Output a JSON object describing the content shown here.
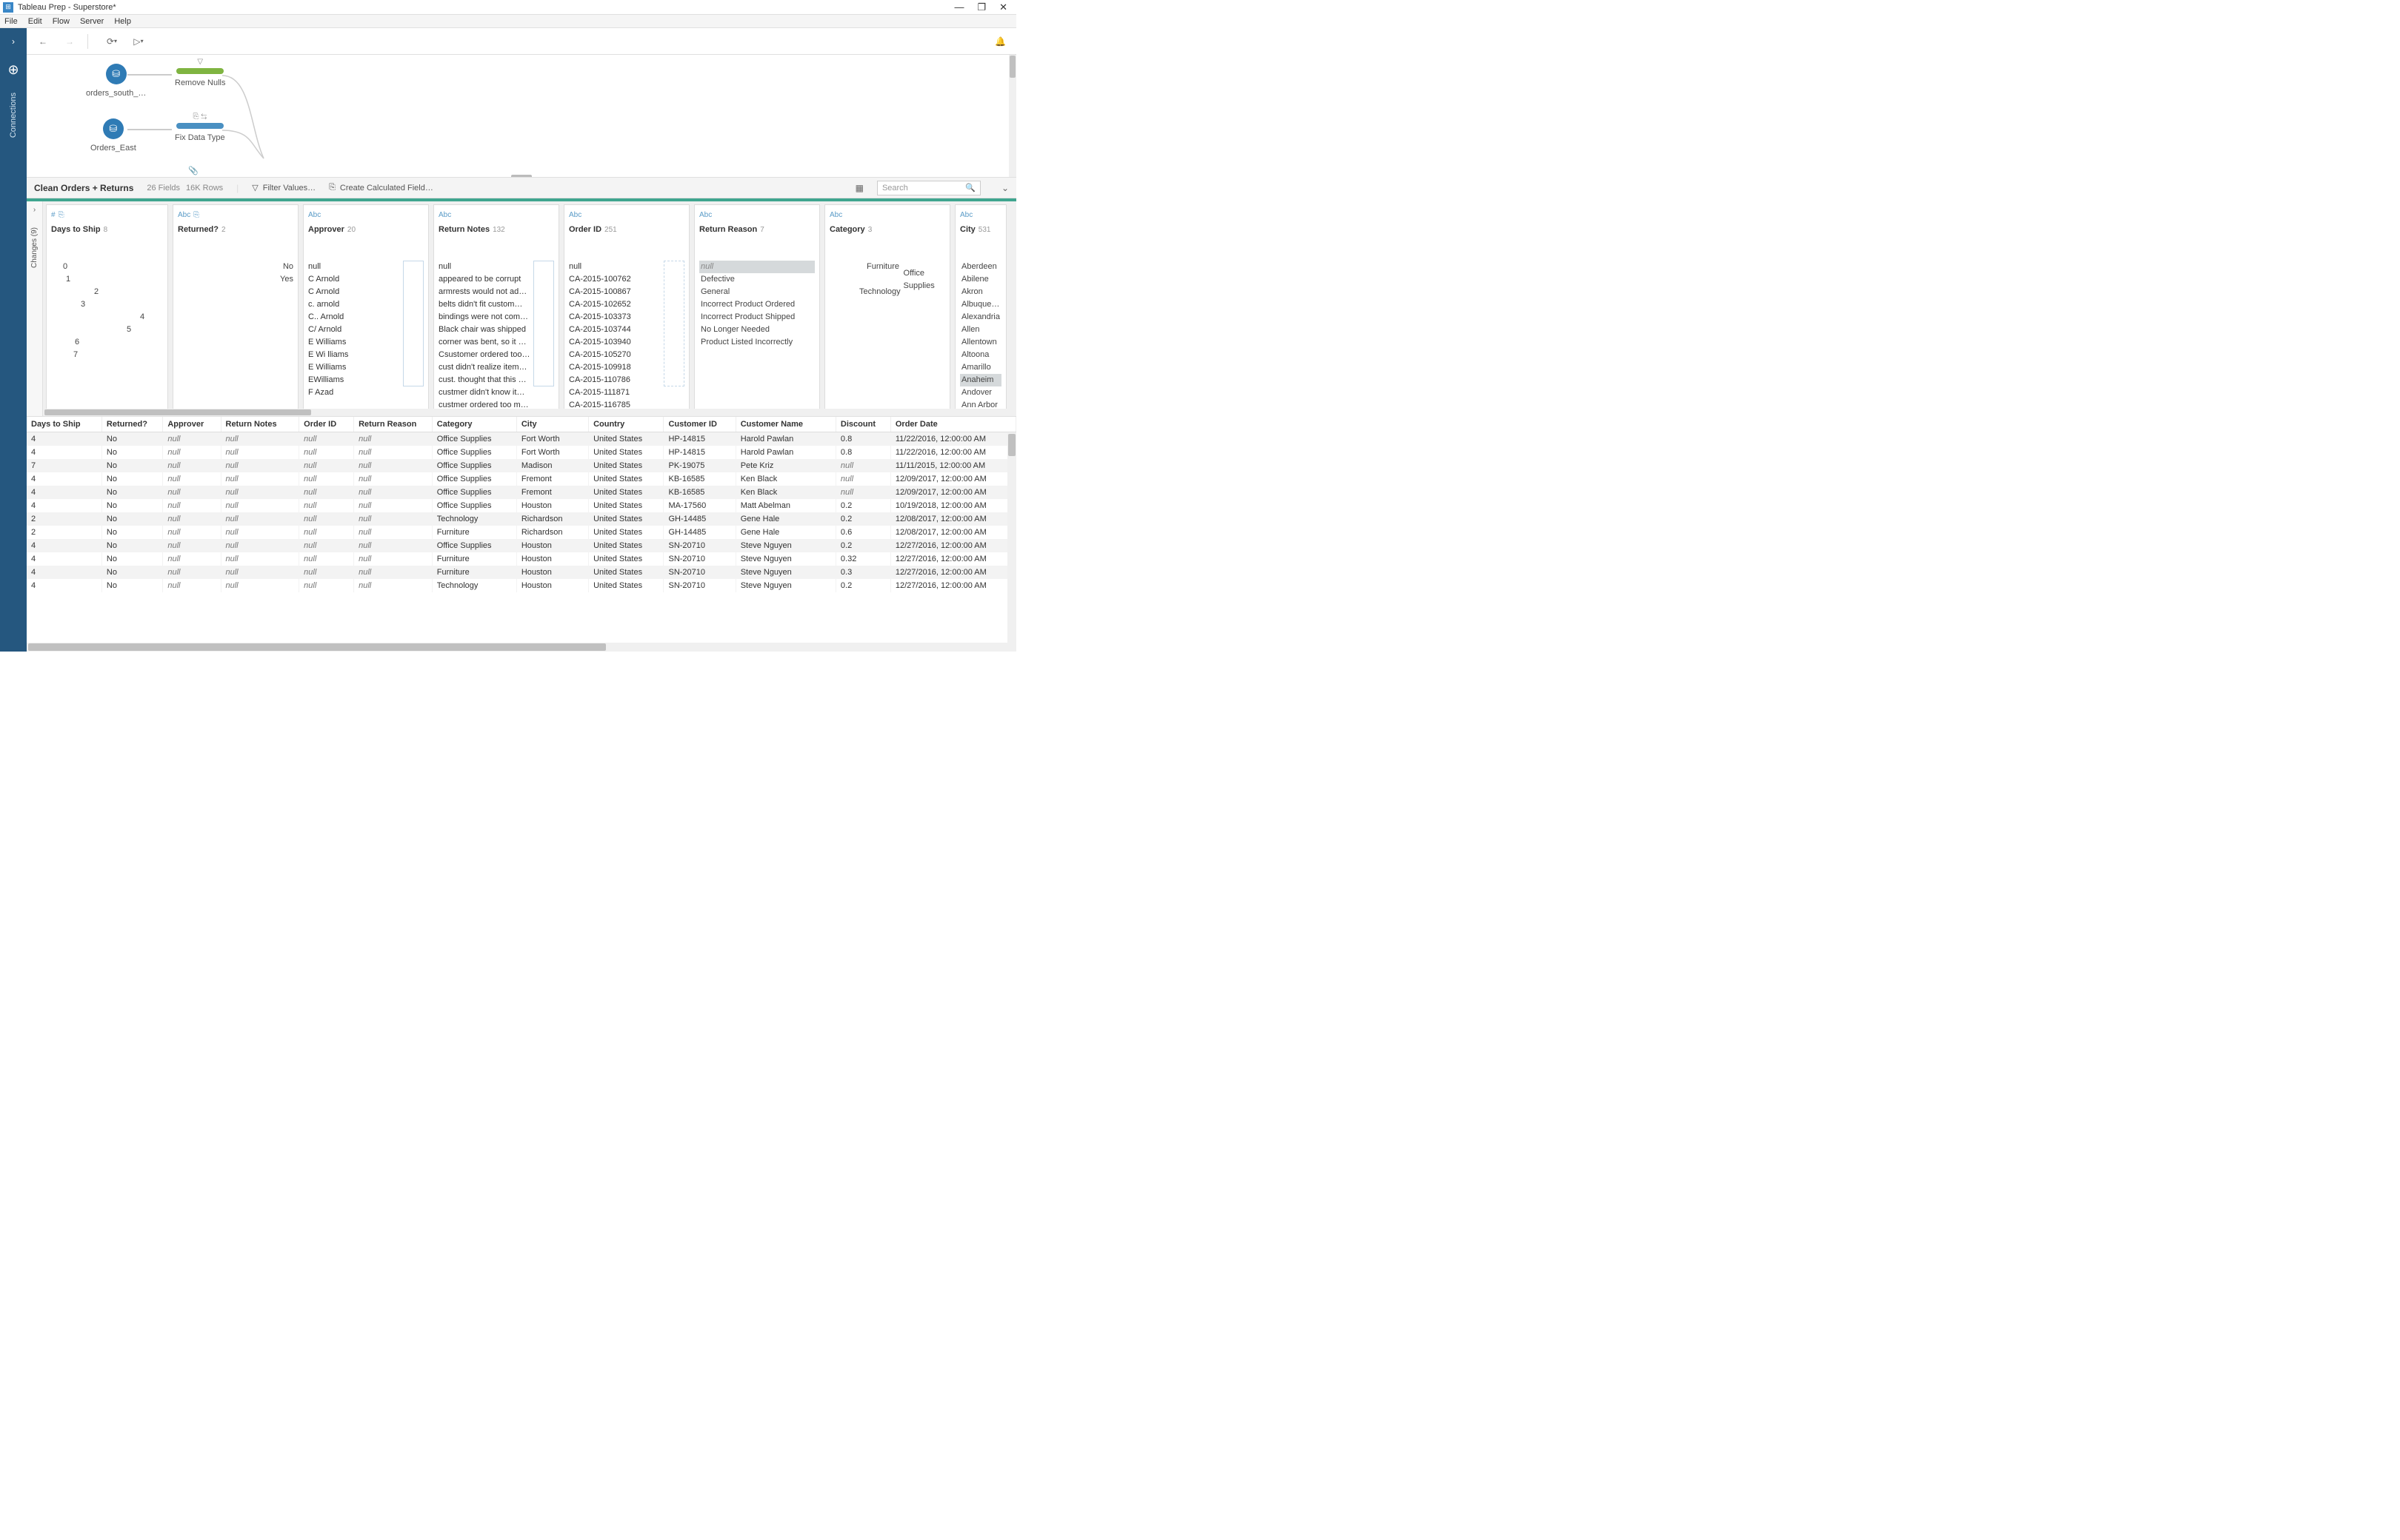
{
  "title": "Tableau Prep - Superstore*",
  "menu": [
    "File",
    "Edit",
    "Flow",
    "Server",
    "Help"
  ],
  "left_rail_label": "Connections",
  "flow": {
    "nodes": [
      {
        "id": "orders_south",
        "label": "orders_south_…",
        "kind": "source"
      },
      {
        "id": "remove_nulls",
        "label": "Remove Nulls",
        "kind": "clean",
        "color": "green",
        "icon": "filter"
      },
      {
        "id": "orders_east",
        "label": "Orders_East",
        "kind": "source"
      },
      {
        "id": "fix_type",
        "label": "Fix Data Type",
        "kind": "clean",
        "color": "blue",
        "icon": "rename"
      }
    ]
  },
  "step": {
    "name": "Clean Orders + Returns",
    "fields": "26 Fields",
    "rows": "16K Rows",
    "filter_label": "Filter Values…",
    "calc_label": "Create Calculated Field…",
    "search_placeholder": "Search"
  },
  "changes_label": "Changes (9)",
  "profile_cards": [
    {
      "type": "#",
      "icon2": "calc",
      "name": "Days to Ship",
      "count": "8",
      "mode": "bars",
      "bars": [
        {
          "lbl": "0",
          "w": 16
        },
        {
          "lbl": "1",
          "w": 20
        },
        {
          "lbl": "2",
          "w": 58
        },
        {
          "lbl": "3",
          "w": 40
        },
        {
          "lbl": "4",
          "w": 120
        },
        {
          "lbl": "5",
          "w": 102
        },
        {
          "lbl": "6",
          "w": 32
        },
        {
          "lbl": "7",
          "w": 30
        }
      ]
    },
    {
      "type": "Abc",
      "icon2": "calc",
      "name": "Returned?",
      "count": "2",
      "mode": "bars_wide",
      "bars": [
        {
          "lbl": "No",
          "w": 150
        },
        {
          "lbl": "Yes",
          "w": 150
        }
      ]
    },
    {
      "type": "Abc",
      "name": "Approver",
      "count": "20",
      "mode": "list_box",
      "values": [
        "null",
        "",
        "C  Arnold",
        "C Arnold",
        "c. arnold",
        "C.. Arnold",
        "C/ Arnold",
        "E   Williams",
        "E Wi lliams",
        "E Williams",
        "EWilliams",
        "F Azad"
      ]
    },
    {
      "type": "Abc",
      "name": "Return Notes",
      "count": "132",
      "mode": "list_box",
      "values": [
        "null",
        "appeared to be corrupt",
        "armrests would not ad…",
        "belts didn't fit custom…",
        "bindings were not com…",
        "Black chair was shipped",
        "corner was bent, so it …",
        "Csustomer ordered too…",
        "cust didn't realize item…",
        "cust. thought that this …",
        "custmer didn't know it…",
        "custmer ordered too m…"
      ]
    },
    {
      "type": "Abc",
      "name": "Order ID",
      "count": "251",
      "mode": "list_box_dashed",
      "values": [
        "null",
        "CA-2015-100762",
        "CA-2015-100867",
        "CA-2015-102652",
        "CA-2015-103373",
        "CA-2015-103744",
        "CA-2015-103940",
        "CA-2015-105270",
        "CA-2015-109918",
        "CA-2015-110786",
        "CA-2015-111871",
        "CA-2015-116785"
      ]
    },
    {
      "type": "Abc",
      "name": "Return Reason",
      "count": "7",
      "mode": "list",
      "values": [
        "null",
        "Defective",
        "General",
        "Incorrect Product Ordered",
        "Incorrect Product Shipped",
        "No Longer Needed",
        "Product Listed Incorrectly"
      ]
    },
    {
      "type": "Abc",
      "name": "Category",
      "count": "3",
      "mode": "bars_wide",
      "bars": [
        {
          "lbl": "Furniture",
          "w": 50,
          "sel": true
        },
        {
          "lbl": "Office Supplies",
          "w": 130,
          "sel": true
        },
        {
          "lbl": "Technology",
          "w": 40,
          "sel": true
        }
      ]
    },
    {
      "type": "Abc",
      "name": "City",
      "count": "531",
      "mode": "list_clip",
      "values": [
        "Aberdeen",
        "Abilene",
        "Akron",
        "Albuquerqu",
        "Alexandria",
        "Allen",
        "Allentown",
        "Altoona",
        "Amarillo",
        "Anaheim",
        "Andover",
        "Ann Arbor"
      ],
      "selected": "Anaheim"
    }
  ],
  "grid": {
    "headers": [
      "Days to Ship",
      "Returned?",
      "Approver",
      "Return Notes",
      "Order ID",
      "Return Reason",
      "Category",
      "City",
      "Country",
      "Customer ID",
      "Customer Name",
      "Discount",
      "Order Date"
    ],
    "rows": [
      [
        "4",
        "No",
        "null",
        "null",
        "null",
        "null",
        "Office Supplies",
        "Fort Worth",
        "United States",
        "HP-14815",
        "Harold Pawlan",
        "0.8",
        "11/22/2016, 12:00:00 AM"
      ],
      [
        "4",
        "No",
        "null",
        "null",
        "null",
        "null",
        "Office Supplies",
        "Fort Worth",
        "United States",
        "HP-14815",
        "Harold Pawlan",
        "0.8",
        "11/22/2016, 12:00:00 AM"
      ],
      [
        "7",
        "No",
        "null",
        "null",
        "null",
        "null",
        "Office Supplies",
        "Madison",
        "United States",
        "PK-19075",
        "Pete Kriz",
        "null",
        "11/11/2015, 12:00:00 AM"
      ],
      [
        "4",
        "No",
        "null",
        "null",
        "null",
        "null",
        "Office Supplies",
        "Fremont",
        "United States",
        "KB-16585",
        "Ken Black",
        "null",
        "12/09/2017, 12:00:00 AM"
      ],
      [
        "4",
        "No",
        "null",
        "null",
        "null",
        "null",
        "Office Supplies",
        "Fremont",
        "United States",
        "KB-16585",
        "Ken Black",
        "null",
        "12/09/2017, 12:00:00 AM"
      ],
      [
        "4",
        "No",
        "null",
        "null",
        "null",
        "null",
        "Office Supplies",
        "Houston",
        "United States",
        "MA-17560",
        "Matt Abelman",
        "0.2",
        "10/19/2018, 12:00:00 AM"
      ],
      [
        "2",
        "No",
        "null",
        "null",
        "null",
        "null",
        "Technology",
        "Richardson",
        "United States",
        "GH-14485",
        "Gene Hale",
        "0.2",
        "12/08/2017, 12:00:00 AM"
      ],
      [
        "2",
        "No",
        "null",
        "null",
        "null",
        "null",
        "Furniture",
        "Richardson",
        "United States",
        "GH-14485",
        "Gene Hale",
        "0.6",
        "12/08/2017, 12:00:00 AM"
      ],
      [
        "4",
        "No",
        "null",
        "null",
        "null",
        "null",
        "Office Supplies",
        "Houston",
        "United States",
        "SN-20710",
        "Steve Nguyen",
        "0.2",
        "12/27/2016, 12:00:00 AM"
      ],
      [
        "4",
        "No",
        "null",
        "null",
        "null",
        "null",
        "Furniture",
        "Houston",
        "United States",
        "SN-20710",
        "Steve Nguyen",
        "0.32",
        "12/27/2016, 12:00:00 AM"
      ],
      [
        "4",
        "No",
        "null",
        "null",
        "null",
        "null",
        "Furniture",
        "Houston",
        "United States",
        "SN-20710",
        "Steve Nguyen",
        "0.3",
        "12/27/2016, 12:00:00 AM"
      ],
      [
        "4",
        "No",
        "null",
        "null",
        "null",
        "null",
        "Technology",
        "Houston",
        "United States",
        "SN-20710",
        "Steve Nguyen",
        "0.2",
        "12/27/2016, 12:00:00 AM"
      ]
    ]
  }
}
